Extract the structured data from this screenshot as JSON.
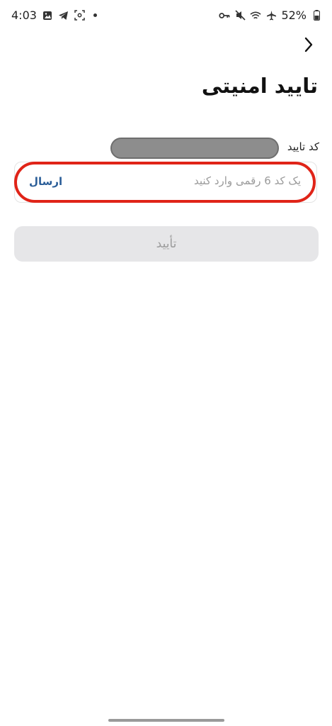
{
  "status_bar": {
    "time": "4:03",
    "battery": "52%",
    "icons_left": [
      "gallery-icon",
      "telegram-icon",
      "screenshot-icon",
      "notification-dot-icon"
    ],
    "icons_right": [
      "key-icon",
      "mute-icon",
      "wifi-icon",
      "airplane-icon",
      "battery-icon"
    ]
  },
  "header": {
    "back_icon": "chevron-right-icon",
    "title": "تایید امنیتی"
  },
  "form": {
    "field_label": "کد تایید",
    "code_input": {
      "value": "",
      "placeholder": "یک کد 6 رقمی وارد کنید"
    },
    "send_label": "ارسال",
    "confirm_label": "تأیید"
  },
  "colors": {
    "highlight": "#e02418",
    "link": "#2b5e98",
    "disabled_button_bg": "#e6e6e8",
    "disabled_button_text": "#9b9b9b"
  }
}
